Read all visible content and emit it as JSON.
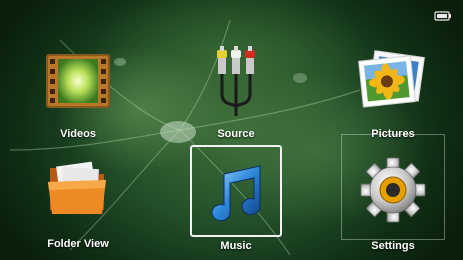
{
  "menu": {
    "items": [
      {
        "id": "videos",
        "label": "Videos",
        "icon": "film-strip-icon",
        "selected": false
      },
      {
        "id": "source",
        "label": "Source",
        "icon": "av-cable-icon",
        "selected": false
      },
      {
        "id": "pictures",
        "label": "Pictures",
        "icon": "photo-flower-icon",
        "selected": false
      },
      {
        "id": "folder-view",
        "label": "Folder View",
        "icon": "folder-icon",
        "selected": false
      },
      {
        "id": "music",
        "label": "Music",
        "icon": "music-note-icon",
        "selected": true
      },
      {
        "id": "settings",
        "label": "Settings",
        "icon": "gear-icon",
        "selected": false
      }
    ]
  },
  "status": {
    "battery_icon": "battery-icon"
  },
  "colors": {
    "label": "#ffffff",
    "selection_border": "#f2f2f2",
    "background": "#23502a"
  }
}
